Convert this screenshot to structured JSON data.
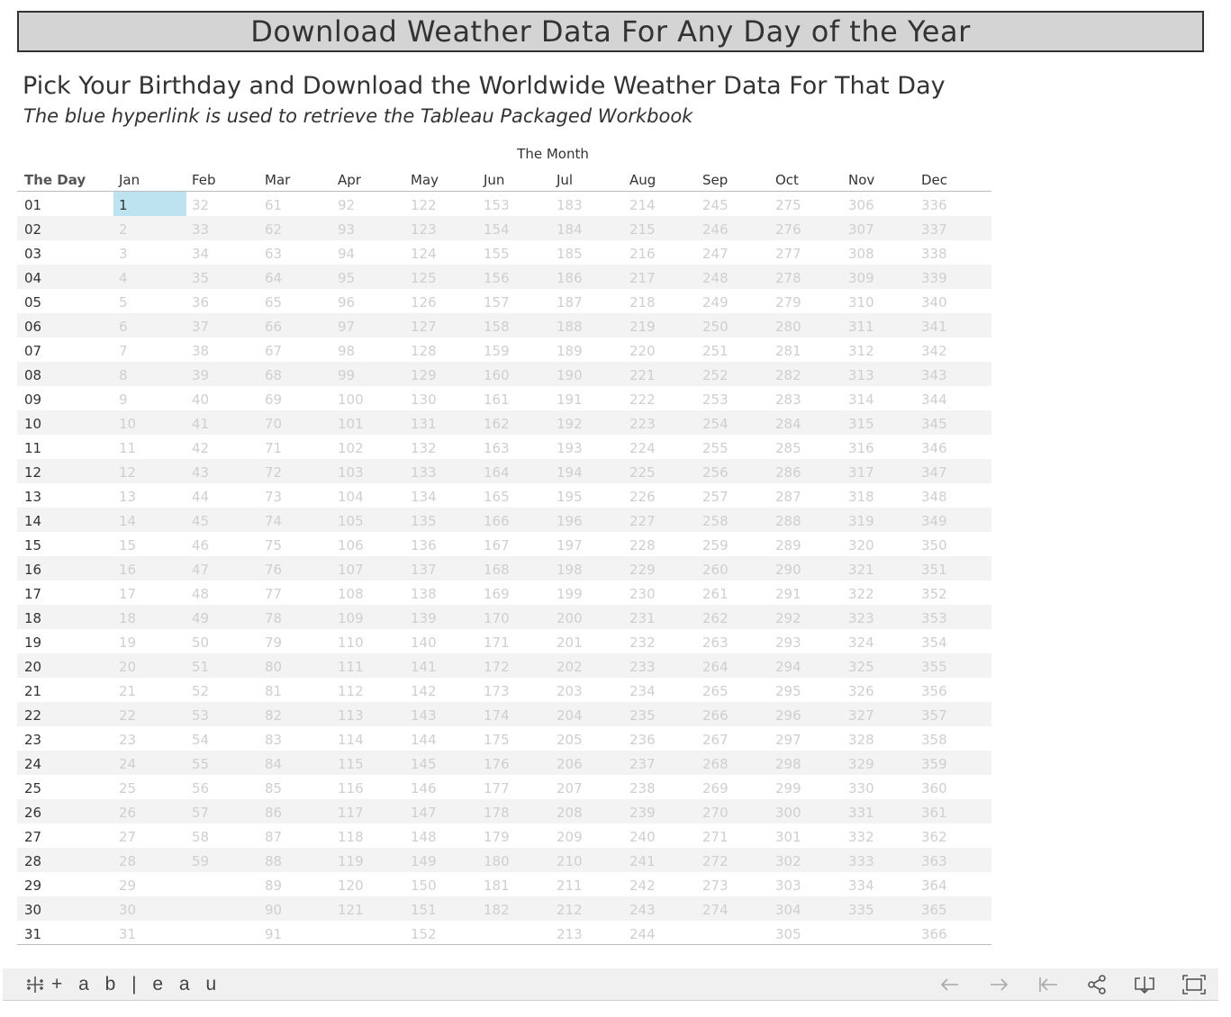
{
  "banner": {
    "title": "Download Weather Data For Any Day of the Year"
  },
  "subtitle": "Pick Your Birthday and Download the Worldwide Weather Data For That Day",
  "note": "The blue hyperlink is used to retrieve the Tableau Packaged Workbook",
  "table": {
    "month_caption": "The Month",
    "day_header": "The Day",
    "months": [
      "Jan",
      "Feb",
      "Mar",
      "Apr",
      "May",
      "Jun",
      "Jul",
      "Aug",
      "Sep",
      "Oct",
      "Nov",
      "Dec"
    ],
    "days": [
      "01",
      "02",
      "03",
      "04",
      "05",
      "06",
      "07",
      "08",
      "09",
      "10",
      "11",
      "12",
      "13",
      "14",
      "15",
      "16",
      "17",
      "18",
      "19",
      "20",
      "21",
      "22",
      "23",
      "24",
      "25",
      "26",
      "27",
      "28",
      "29",
      "30",
      "31"
    ],
    "days_in_month": [
      31,
      28,
      31,
      30,
      31,
      30,
      31,
      31,
      30,
      31,
      30,
      31
    ],
    "day_of_year_offsets": [
      0,
      31,
      60,
      91,
      121,
      152,
      182,
      213,
      244,
      274,
      305,
      335
    ],
    "selected": {
      "month": "Jan",
      "day": "01",
      "value": "1"
    }
  },
  "colors": {
    "selected_bg": "#bde3f1",
    "muted_value": "#cfcfcf",
    "banner_bg": "#d4d4d4"
  },
  "footer": {
    "logo_text": "+ a b | e a u",
    "icons": [
      "undo-icon",
      "redo-icon",
      "revert-icon",
      "share-icon",
      "download-icon",
      "fullscreen-icon"
    ]
  }
}
